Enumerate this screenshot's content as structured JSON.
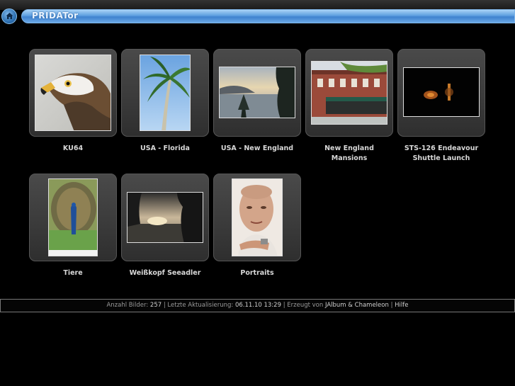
{
  "header": {
    "title": "PRIDATor",
    "home_icon": "home-icon",
    "accent_color": "#4f92d8"
  },
  "albums": [
    {
      "label": "KU64"
    },
    {
      "label": "USA - Florida"
    },
    {
      "label": "USA - New England"
    },
    {
      "label": "New England\nMansions"
    },
    {
      "label": "STS-126 Endeavour\nShuttle Launch"
    },
    {
      "label": "Tiere"
    },
    {
      "label": "Weißkopf Seeadler"
    },
    {
      "label": "Portraits"
    }
  ],
  "footer": {
    "count_label": "Anzahl Bilder:",
    "count_value": "257",
    "updated_label": "Letzte Aktualisierung:",
    "updated_value": "06.11.10 13:29",
    "generated_label": "Erzeugt von",
    "jalbum_link": "JAlbum",
    "amp": "&",
    "chameleon_link": "Chameleon",
    "help_link": "Hilfe",
    "sep": "|"
  }
}
